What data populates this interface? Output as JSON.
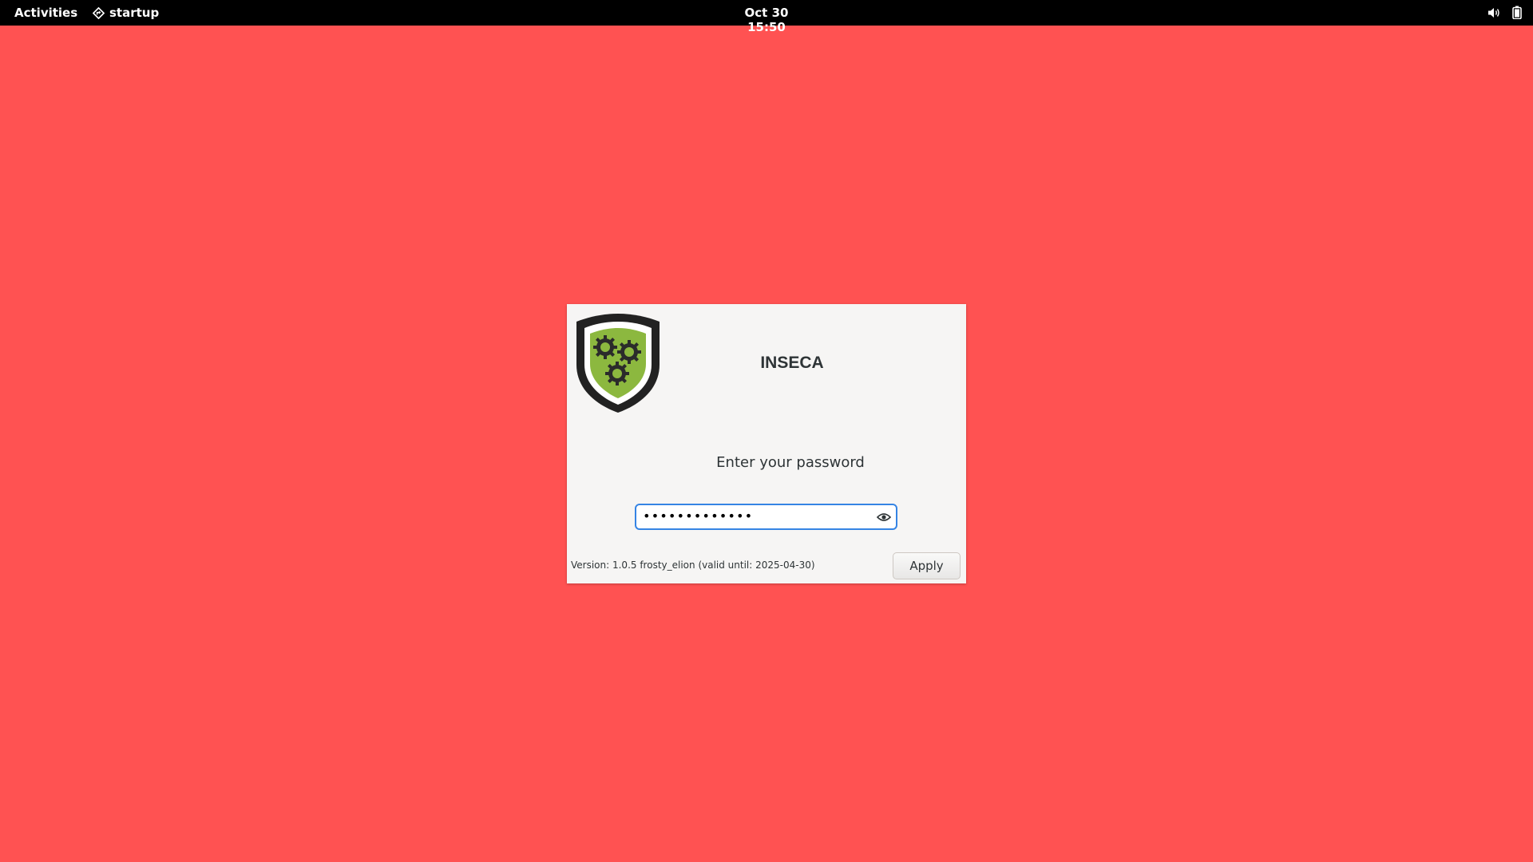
{
  "topbar": {
    "activities_label": "Activities",
    "app_name": "startup",
    "app_icon": "diamond-app-icon",
    "clock": "Oct 30  15:50",
    "tray_icons": [
      "volume-icon",
      "battery-icon"
    ]
  },
  "dialog": {
    "title": "INSECA",
    "logo": "inseca-shield-gears-logo",
    "prompt": "Enter your password",
    "password_masked": "•••••••••••••",
    "reveal_icon": "eye-icon",
    "version": "Version: 1.0.5 frosty_elion (valid until: 2025-04-30)",
    "apply_label": "Apply"
  },
  "colors": {
    "background": "#ff5252",
    "topbar": "#000000",
    "dialog": "#f6f5f4",
    "focus": "#3584e4",
    "shield_green": "#8cb83f"
  }
}
